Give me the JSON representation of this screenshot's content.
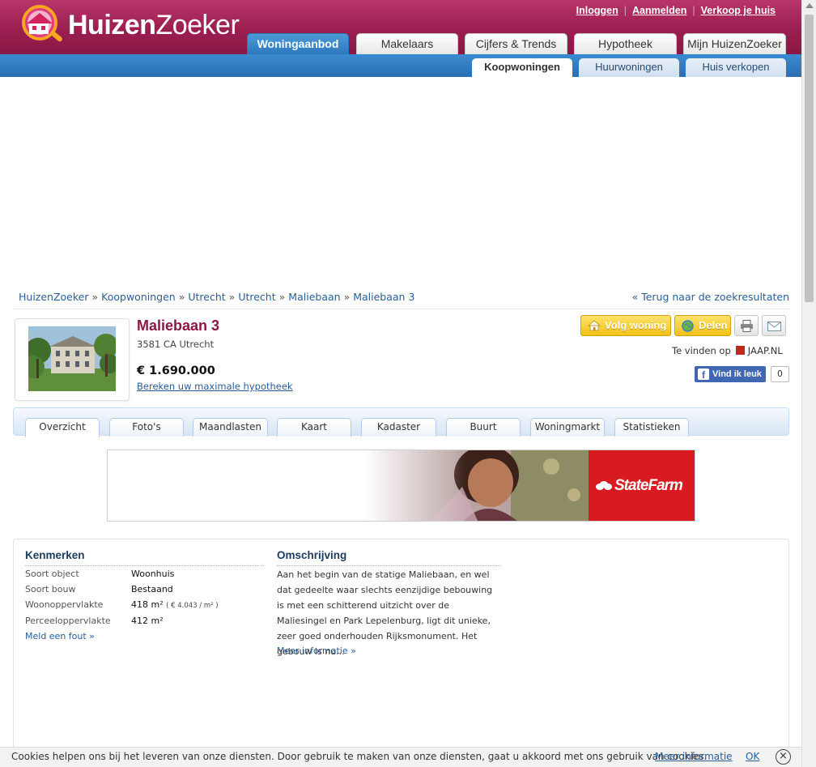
{
  "header": {
    "logo_bold": "Huizen",
    "logo_light": "Zoeker",
    "top_links": [
      "Inloggen",
      "Aanmelden",
      "Verkoop je huis"
    ],
    "main_tabs": [
      "Woningaanbod",
      "Makelaars",
      "Cijfers & Trends",
      "Hypotheek",
      "Mijn HuizenZoeker"
    ],
    "active_main_tab": "Woningaanbod",
    "sub_tabs": [
      "Koopwoningen",
      "Huurwoningen",
      "Huis verkopen"
    ],
    "active_sub_tab": "Koopwoningen"
  },
  "breadcrumb": {
    "items": [
      "HuizenZoeker",
      "Koopwoningen",
      "Utrecht",
      "Utrecht",
      "Maliebaan",
      "Maliebaan 3"
    ],
    "separator": "»",
    "back_link": "« Terug naar de zoekresultaten"
  },
  "property": {
    "title": "Maliebaan 3",
    "postal": "3581 CA Utrecht",
    "price": "€ 1.690.000",
    "mortgage_link": "Bereken uw maximale hypotheek",
    "follow_button": "Volg woning",
    "share_button": "Delen",
    "found_on_label": "Te vinden op",
    "found_on_site": "JAAP.NL",
    "facebook_like": "Vind ik leuk",
    "facebook_count": "0"
  },
  "detail_tabs": [
    "Overzicht",
    "Foto's",
    "Maandlasten",
    "Kaart",
    "Kadaster",
    "Buurt",
    "Woningmarkt",
    "Statistieken"
  ],
  "active_detail_tab": "Overzicht",
  "ad": {
    "brand": "StateFarm",
    "brand_color": "#d81a21"
  },
  "kenmerken": {
    "title": "Kenmerken",
    "rows": [
      {
        "label": "Soort object",
        "value": "Woonhuis",
        "extra": ""
      },
      {
        "label": "Soort bouw",
        "value": "Bestaand",
        "extra": ""
      },
      {
        "label": "Woonoppervlakte",
        "value": "418 m²",
        "extra": "( € 4.043 / m² )"
      },
      {
        "label": "Perceeloppervlakte",
        "value": "412 m²",
        "extra": ""
      }
    ],
    "report_link": "Meld een fout »"
  },
  "omschrijving": {
    "title": "Omschrijving",
    "text": "Aan het begin van de statige Maliebaan, en wel dat gedeelte waar slechts eenzijdige bebouwing is met een schitterend uitzicht over de Maliesingel en Park Lepelenburg, ligt dit unieke, zeer goed onderhouden Rijksmonument. Het gebouw is nu...",
    "more_link": "Meer informatie »"
  },
  "cookie_bar": {
    "text": "Cookies helpen ons bij het leveren van onze diensten. Door gebruik te maken van onze diensten, gaat u akkoord met ons gebruik van cookies.",
    "more_link": "Meer informatie",
    "ok": "OK",
    "close": "×"
  },
  "colors": {
    "brand_magenta": "#9b1f50",
    "nav_blue": "#2d78be",
    "title_color": "#8a1745",
    "link_blue": "#2a5d94",
    "button_yellow": "#f3c218"
  }
}
